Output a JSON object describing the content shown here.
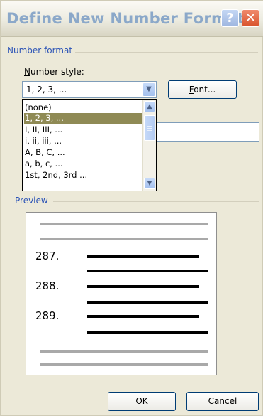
{
  "window": {
    "title": "Define New Number Format",
    "help_glyph": "?",
    "close_glyph": "✕"
  },
  "number_format": {
    "section_label": "Number format",
    "style_label_mnemonic": "N",
    "style_label_rest": "umber style:",
    "selected_value": "1, 2, 3, ...",
    "font_button_mnemonic": "F",
    "font_button_rest": "ont...",
    "options": [
      "(none)",
      "1, 2, 3, ...",
      "I, II, III, ...",
      "i, ii, iii, ...",
      "A, B, C, ...",
      "a, b, c, ...",
      "1st, 2nd, 3rd ..."
    ],
    "selected_index": 1
  },
  "preview": {
    "section_label": "Preview",
    "numbers": [
      "287.",
      "288.",
      "289."
    ]
  },
  "buttons": {
    "ok": "OK",
    "cancel": "Cancel"
  },
  "colors": {
    "title_text": "#8ba8c9",
    "section_label": "#2b53b6",
    "selection": "#8f8a55"
  }
}
